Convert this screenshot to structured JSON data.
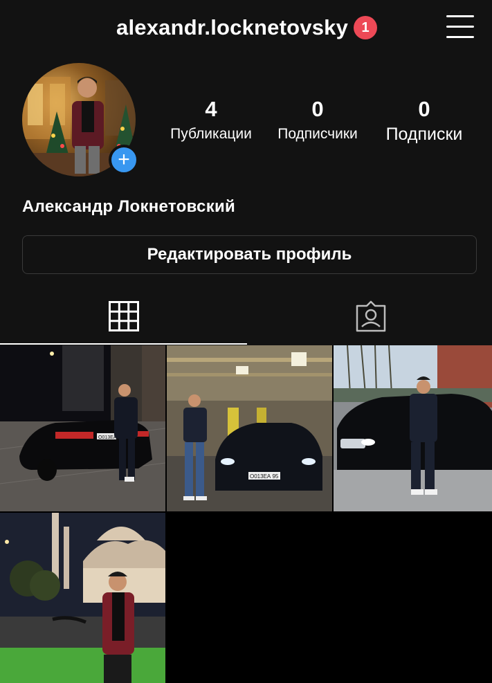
{
  "header": {
    "username": "alexandr.locknetovsky",
    "notification_count": "1"
  },
  "profile": {
    "full_name": "Александр Локнетовский",
    "stats": [
      {
        "value": "4",
        "label": "Публикации"
      },
      {
        "value": "0",
        "label": "Подписчики"
      },
      {
        "value": "0",
        "label": "Подписки"
      }
    ],
    "edit_button_label": "Редактировать профиль"
  },
  "tabs": [
    {
      "icon": "grid-icon",
      "active": true
    },
    {
      "icon": "tagged-icon",
      "active": false
    }
  ],
  "posts": [
    {
      "plate_text": "О013ЕА"
    },
    {
      "plate_text": "О013ЕА 95"
    },
    {},
    {}
  ],
  "colors": {
    "background": "#121212",
    "badge": "#ed4956",
    "add_button": "#3897f0"
  }
}
